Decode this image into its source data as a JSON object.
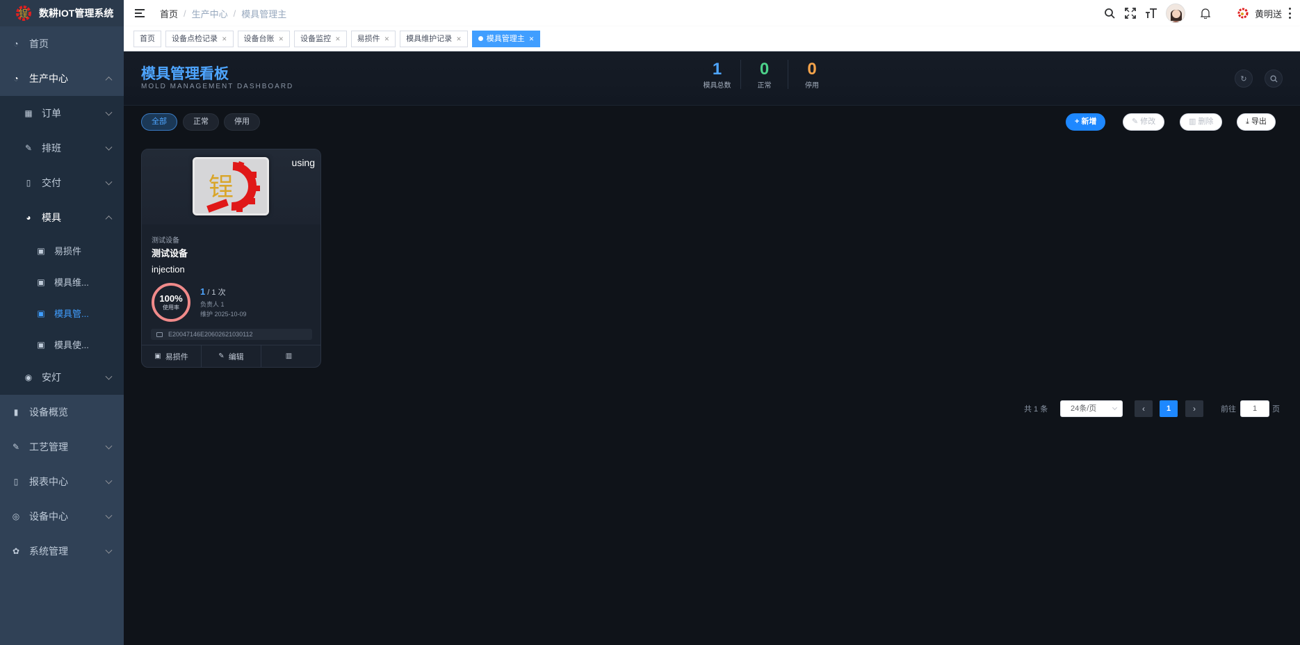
{
  "app": {
    "title": "数耕IOT管理系统"
  },
  "sidebar": {
    "home": "首页",
    "production": "生产中心",
    "order": "订单",
    "schedule": "排班",
    "delivery": "交付",
    "mold": "模具",
    "mold_children": [
      "易损件",
      "模具维...",
      "模具管...",
      "模具使..."
    ],
    "andon": "安灯",
    "device_overview": "设备概览",
    "process": "工艺管理",
    "report": "报表中心",
    "device_center": "设备中心",
    "system": "系统管理"
  },
  "header": {
    "breadcrumb": [
      "首页",
      "生产中心",
      "模具管理主"
    ],
    "user_name": "黄明送"
  },
  "tags": [
    "首页",
    "设备点检记录",
    "设备台账",
    "设备监控",
    "易损件",
    "模具维护记录",
    "模具管理主"
  ],
  "dashboard": {
    "title": "模具管理看板",
    "subtitle": "MOLD MANAGEMENT DASHBOARD",
    "stats": [
      {
        "value": "1",
        "label": "模具总数",
        "color": "#4ea5ff"
      },
      {
        "value": "0",
        "label": "正常",
        "color": "#4cd18a"
      },
      {
        "value": "0",
        "label": "停用",
        "color": "#f5a34a"
      }
    ]
  },
  "filters": [
    "全部",
    "正常",
    "停用"
  ],
  "actions": {
    "add": "新增",
    "edit": "修改",
    "delete": "删除",
    "export": "导出"
  },
  "card": {
    "status": "using",
    "category": "测试设备",
    "name": "测试设备",
    "type": "injection",
    "usage_rate": "100%",
    "usage_rate_label": "使用率",
    "usage_current": "1",
    "usage_total": " / 1 次",
    "owner": "负责人 1",
    "maintenance": "维护 2025-10-09",
    "code": "E20047146E20602621030112",
    "foot": {
      "parts": "易损件",
      "edit": "编辑"
    }
  },
  "pagination": {
    "total": "共 1 条",
    "page_size": "24条/页",
    "current": "1",
    "goto_label": "前往",
    "goto_value": "1",
    "unit": "页"
  }
}
